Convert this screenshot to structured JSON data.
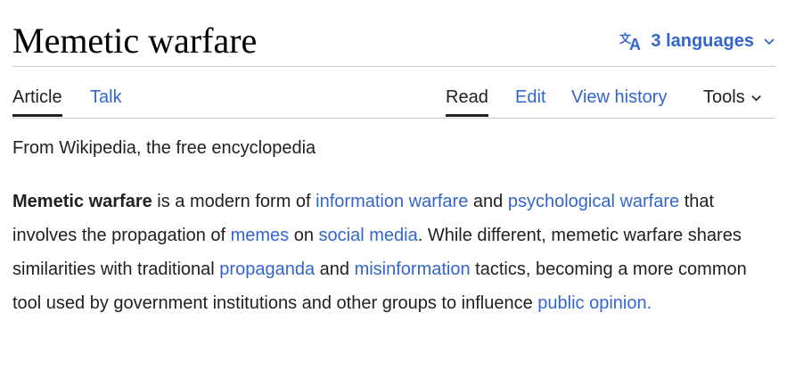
{
  "article": {
    "title": "Memetic warfare",
    "languages_label": "3 languages"
  },
  "tabs": {
    "article": "Article",
    "talk": "Talk",
    "read": "Read",
    "edit": "Edit",
    "view_history": "View history",
    "tools": "Tools"
  },
  "tagline": "From Wikipedia, the free encyclopedia",
  "paragraph": {
    "bold": "Memetic warfare",
    "t1": " is a modern form of ",
    "link_info_warfare": "information warfare",
    "t2": " and ",
    "link_psych_warfare": "psychological warfare",
    "t3": " that involves the propagation of ",
    "link_memes": "memes",
    "t4": " on ",
    "link_social_media": "social media",
    "t5": ". While different, memetic warfare shares similarities with traditional ",
    "link_propaganda": "propaganda",
    "t6": " and ",
    "link_misinformation": "misinformation",
    "t7": " tactics, becoming a more common tool used by government institutions and other groups to influence ",
    "link_public_opinion": "public opinion."
  },
  "colors": {
    "link": "#3366cc",
    "text": "#202122",
    "divider": "#c8ccd1"
  },
  "icons": {
    "languages": "translate-icon",
    "dropdown": "chevron-down-icon"
  }
}
